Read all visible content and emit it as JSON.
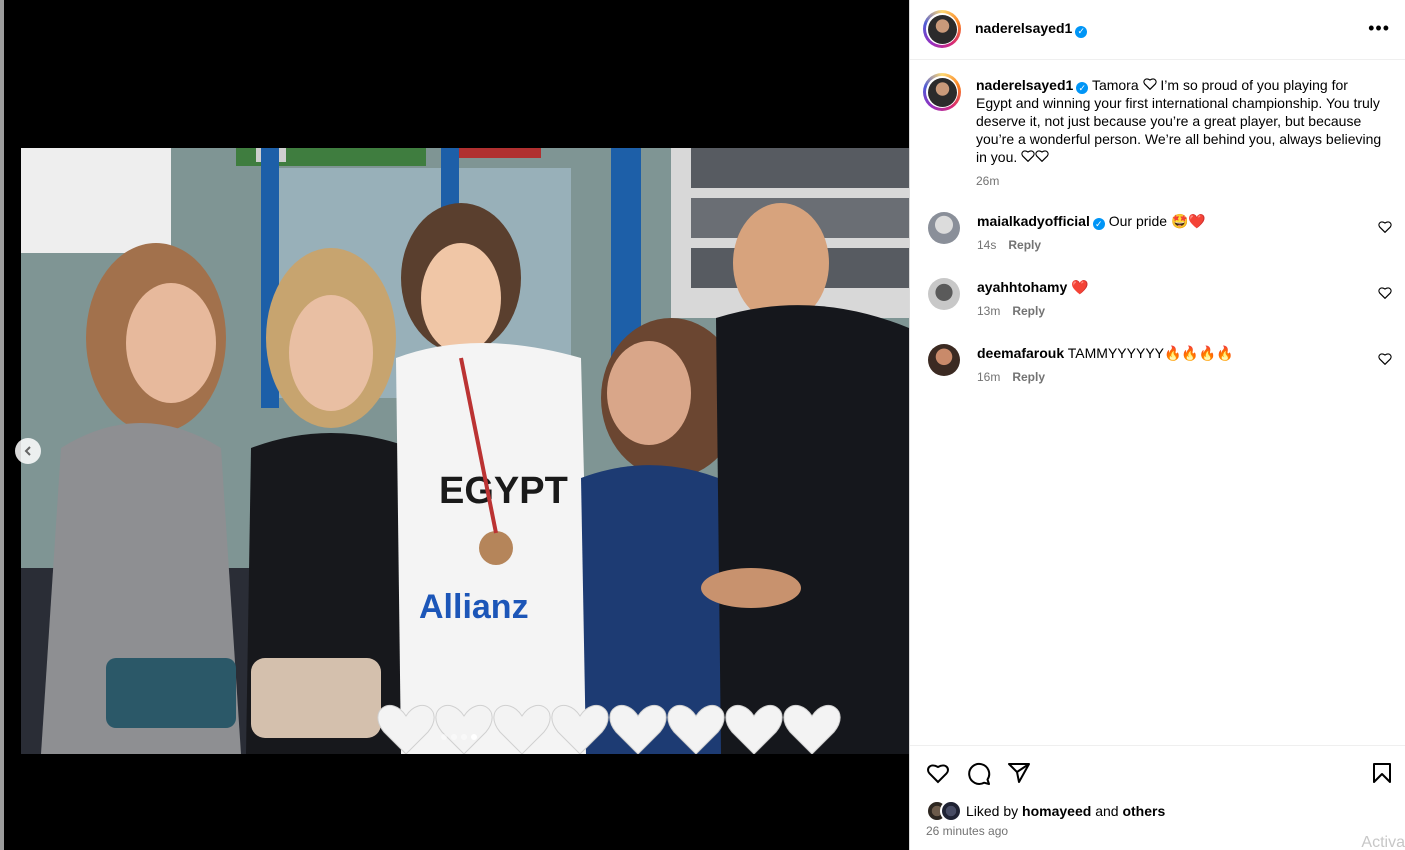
{
  "post": {
    "username": "naderelsayed1",
    "verified": true,
    "more_label": "•••"
  },
  "caption": {
    "username": "naderelsayed1",
    "text_part1": "Tamora ",
    "text_part2": "I’m so proud of you playing for Egypt and winning your first international championship. You truly deserve it, not just because you’re a great player, but because you’re a wonderful person. We’re all behind you, always believing in you.",
    "time": "26m"
  },
  "media": {
    "prev_icon": "chevron-left-icon",
    "jersey_text": "EGYPT",
    "sponsor_text": "Allianz",
    "slide_count": 4,
    "active_slide": 4
  },
  "comments": [
    {
      "username": "maialkadyofficial",
      "verified": true,
      "text": "Our pride 🤩❤️",
      "time": "14s",
      "reply": "Reply"
    },
    {
      "username": "ayahhtohamy",
      "verified": false,
      "text": "❤️",
      "time": "13m",
      "reply": "Reply"
    },
    {
      "username": "deemafarouk",
      "verified": false,
      "text": "TAMMYYYYYY🔥🔥🔥🔥",
      "time": "16m",
      "reply": "Reply"
    }
  ],
  "actions": {
    "liked_prefix": "Liked by ",
    "liked_user": "homayeed",
    "liked_and": " and ",
    "liked_others": "others",
    "timestamp": "26 minutes ago"
  },
  "watermark": "Activa",
  "colors": {
    "verified": "#0095f6",
    "meta": "#737373",
    "border": "#dbdbdb"
  }
}
